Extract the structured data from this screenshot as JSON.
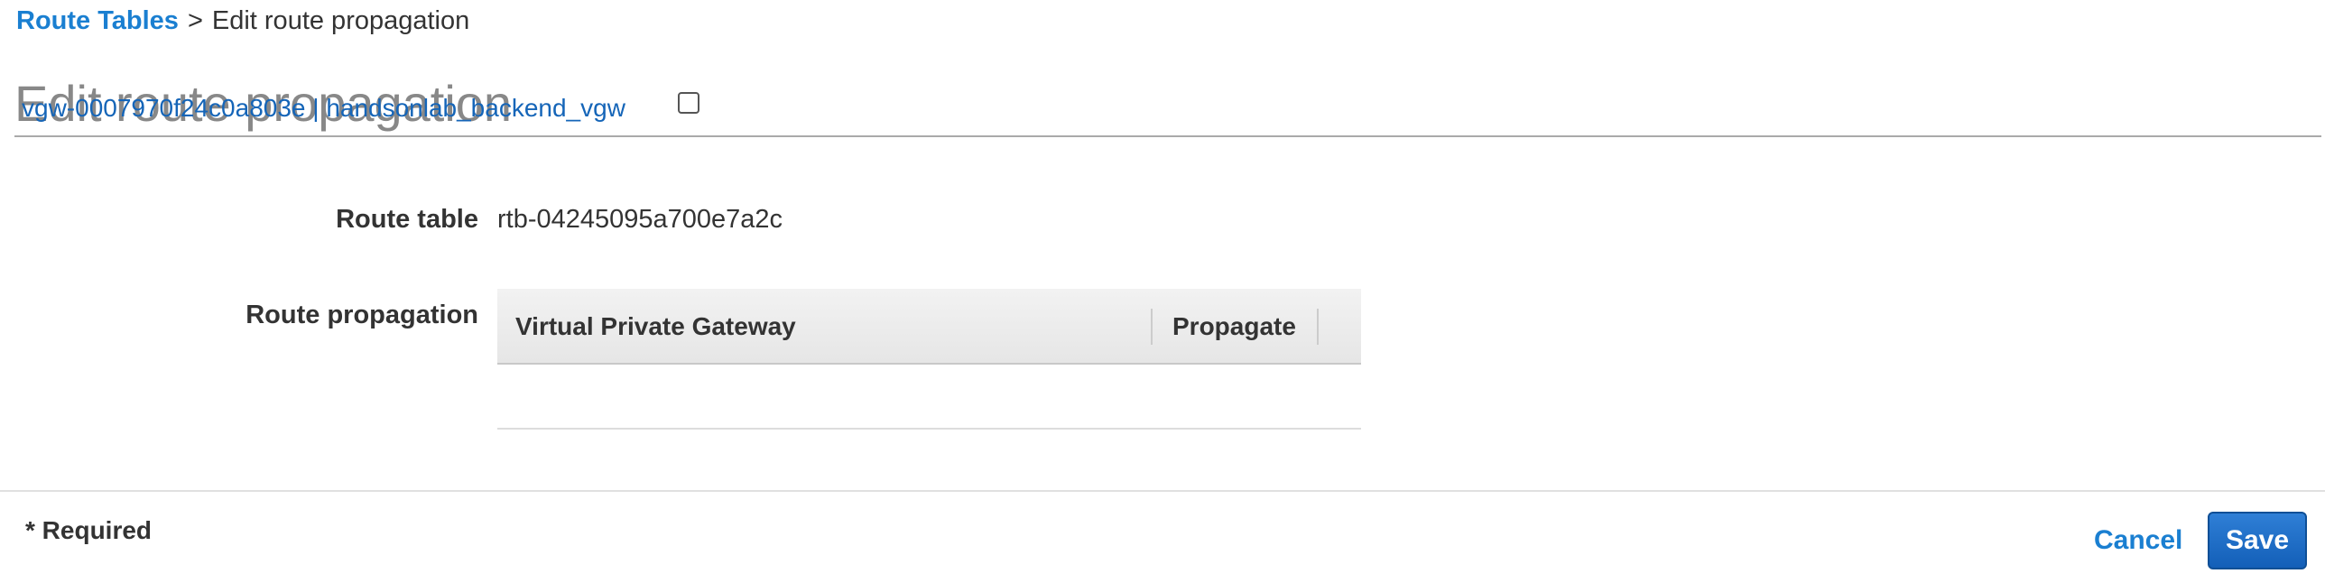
{
  "breadcrumb": {
    "parent_label": "Route Tables",
    "separator": ">",
    "current_label": "Edit route propagation"
  },
  "page": {
    "title": "Edit route propagation"
  },
  "form": {
    "route_table": {
      "label": "Route table",
      "value": "rtb-04245095a700e7a2c"
    },
    "route_propagation": {
      "label": "Route propagation",
      "table": {
        "columns": [
          "Virtual Private Gateway",
          "Propagate"
        ],
        "rows": [
          {
            "gateway": "vgw-0007970f24c0a803e | handsonlab_backend_vgw",
            "propagate": false
          }
        ]
      }
    }
  },
  "footer": {
    "required_note": "* Required",
    "cancel_label": "Cancel",
    "save_label": "Save"
  },
  "colors": {
    "link": "#1a7fd1",
    "gateway_link": "#1565b8",
    "title": "#888888",
    "primary_button": "#1f6fc8"
  }
}
